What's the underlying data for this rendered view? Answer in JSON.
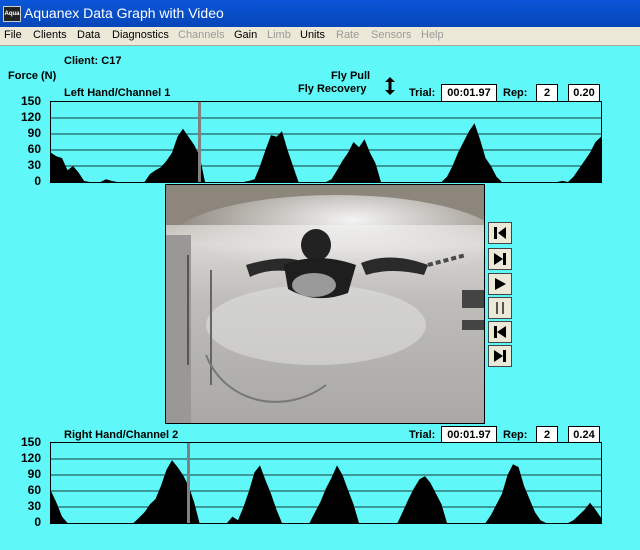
{
  "window": {
    "title": "Aquanex Data Graph with Video",
    "icon_text": "Aqua"
  },
  "menu": [
    {
      "label": "File",
      "enabled": true
    },
    {
      "label": "Clients",
      "enabled": true
    },
    {
      "label": "Data",
      "enabled": true
    },
    {
      "label": "Diagnostics",
      "enabled": true
    },
    {
      "label": "Channels",
      "enabled": false
    },
    {
      "label": "Gain",
      "enabled": true
    },
    {
      "label": "Limb",
      "enabled": false
    },
    {
      "label": "Units",
      "enabled": true
    },
    {
      "label": "Rate",
      "enabled": false
    },
    {
      "label": "Sensors",
      "enabled": false
    },
    {
      "label": "Help",
      "enabled": false
    }
  ],
  "client_label": "Client: C17",
  "force_label": "Force (N)",
  "legend": {
    "pull": "Fly Pull",
    "recovery": "Fly Recovery",
    "icon": "up-down-arrow-icon"
  },
  "top_panel": {
    "title": "Left Hand/Channel 1",
    "trial_label": "Trial:",
    "trial": "00:01.97",
    "rep_label": "Rep:",
    "rep": "2",
    "value": "0.20"
  },
  "bottom_panel": {
    "title": "Right Hand/Channel 2",
    "trial_label": "Trial:",
    "trial": "00:01.97",
    "rep_label": "Rep:",
    "rep": "2",
    "value": "0.24"
  },
  "controls": [
    "skip-to-start-icon",
    "step-forward-icon",
    "play-icon",
    "pause-icon",
    "step-back-icon",
    "skip-to-end-icon"
  ],
  "colors": {
    "background": "#5ff7f7",
    "trace": "#000000",
    "cursor": "#808080"
  },
  "chart_data": [
    {
      "type": "area",
      "ylim": [
        0,
        150
      ],
      "yticks": [
        0,
        30,
        60,
        90,
        120,
        150
      ],
      "cursor_x": 27,
      "x": [
        0,
        1,
        2,
        3,
        4,
        5,
        6,
        7,
        8,
        9,
        10,
        11,
        12,
        13,
        14,
        15,
        16,
        17,
        18,
        19,
        20,
        21,
        22,
        23,
        24,
        25,
        26,
        27,
        28,
        29,
        30,
        31,
        32,
        33,
        34,
        35,
        36,
        37,
        38,
        39,
        40,
        41,
        42,
        43,
        44,
        45,
        46,
        47,
        48,
        49,
        50,
        51,
        52,
        53,
        54,
        55,
        56,
        57,
        58,
        59,
        60,
        61,
        62,
        63,
        64,
        65,
        66,
        67,
        68,
        69,
        70,
        71,
        72,
        73,
        74,
        75,
        76,
        77,
        78,
        79,
        80,
        81,
        82,
        83,
        84,
        85,
        86,
        87,
        88,
        89,
        90,
        91,
        92,
        93,
        94,
        95,
        96,
        97,
        98,
        99,
        100
      ],
      "values": [
        55,
        48,
        45,
        22,
        30,
        18,
        2,
        0,
        0,
        0,
        5,
        2,
        0,
        0,
        0,
        0,
        0,
        0,
        15,
        22,
        28,
        40,
        55,
        85,
        100,
        85,
        70,
        50,
        0,
        0,
        0,
        0,
        0,
        0,
        0,
        0,
        2,
        5,
        30,
        60,
        88,
        85,
        95,
        60,
        30,
        0,
        0,
        0,
        0,
        0,
        0,
        5,
        22,
        40,
        55,
        75,
        65,
        80,
        55,
        35,
        0,
        0,
        0,
        0,
        0,
        0,
        0,
        0,
        0,
        0,
        0,
        0,
        10,
        30,
        55,
        75,
        95,
        110,
        80,
        45,
        30,
        10,
        0,
        0,
        0,
        0,
        0,
        0,
        0,
        0,
        0,
        0,
        0,
        2,
        0,
        10,
        25,
        40,
        55,
        75,
        85
      ]
    },
    {
      "type": "area",
      "ylim": [
        0,
        150
      ],
      "yticks": [
        0,
        30,
        60,
        90,
        120,
        150
      ],
      "cursor_x": 25,
      "x": [
        0,
        1,
        2,
        3,
        4,
        5,
        6,
        7,
        8,
        9,
        10,
        11,
        12,
        13,
        14,
        15,
        16,
        17,
        18,
        19,
        20,
        21,
        22,
        23,
        24,
        25,
        26,
        27,
        28,
        29,
        30,
        31,
        32,
        33,
        34,
        35,
        36,
        37,
        38,
        39,
        40,
        41,
        42,
        43,
        44,
        45,
        46,
        47,
        48,
        49,
        50,
        51,
        52,
        53,
        54,
        55,
        56,
        57,
        58,
        59,
        60,
        61,
        62,
        63,
        64,
        65,
        66,
        67,
        68,
        69,
        70,
        71,
        72,
        73,
        74,
        75,
        76,
        77,
        78,
        79,
        80,
        81,
        82,
        83,
        84,
        85,
        86,
        87,
        88,
        89,
        90,
        91,
        92,
        93,
        94,
        95,
        96,
        97,
        98,
        99,
        100
      ],
      "values": [
        60,
        38,
        12,
        0,
        0,
        0,
        0,
        0,
        0,
        0,
        0,
        0,
        0,
        0,
        0,
        0,
        10,
        20,
        35,
        45,
        70,
        100,
        118,
        105,
        90,
        70,
        40,
        0,
        0,
        0,
        0,
        0,
        0,
        12,
        5,
        30,
        60,
        95,
        108,
        80,
        55,
        25,
        0,
        0,
        0,
        0,
        0,
        0,
        20,
        40,
        65,
        85,
        108,
        90,
        62,
        35,
        0,
        0,
        0,
        0,
        0,
        0,
        0,
        0,
        22,
        45,
        65,
        82,
        88,
        75,
        55,
        35,
        0,
        0,
        0,
        0,
        0,
        0,
        0,
        0,
        15,
        35,
        55,
        90,
        110,
        105,
        70,
        45,
        20,
        5,
        0,
        0,
        0,
        0,
        0,
        5,
        15,
        25,
        38,
        25,
        10
      ]
    }
  ]
}
